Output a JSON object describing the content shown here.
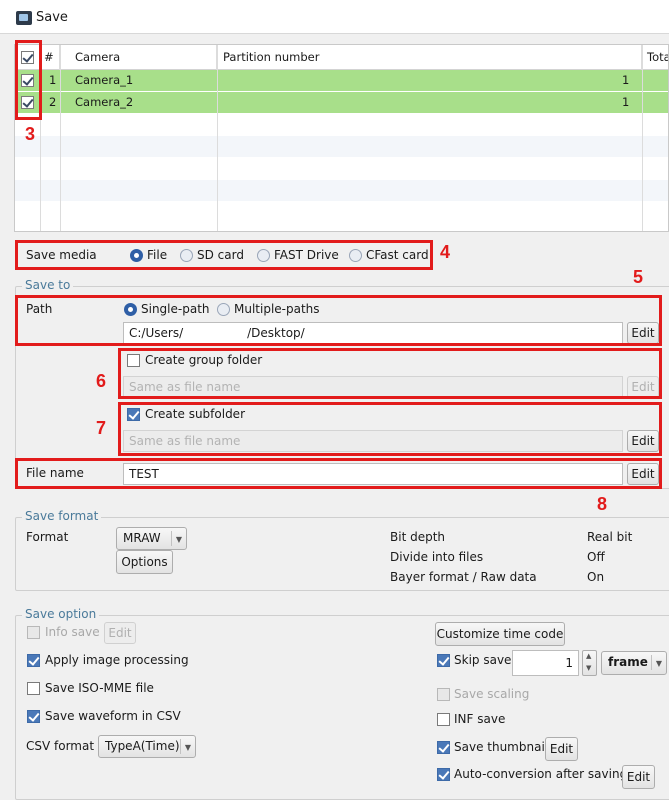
{
  "window": {
    "title": "Save"
  },
  "table": {
    "headers": {
      "index": "#",
      "camera": "Camera",
      "partition": "Partition number",
      "total": "Tota"
    },
    "rows": [
      {
        "index": "1",
        "camera": "Camera_1",
        "partition": "1",
        "checked": true
      },
      {
        "index": "2",
        "camera": "Camera_2",
        "partition": "1",
        "checked": true
      }
    ],
    "header_checked": true
  },
  "save_media": {
    "label": "Save media",
    "options": [
      "File",
      "SD card",
      "FAST Drive",
      "CFast card"
    ],
    "selected": "File"
  },
  "save_to": {
    "title": "Save to",
    "path_label": "Path",
    "path_modes": [
      "Single-path",
      "Multiple-paths"
    ],
    "path_mode_selected": "Single-path",
    "path_value_a": "C:/Users/",
    "path_value_b": "/Desktop/",
    "edit_label": "Edit",
    "group_folder_label": "Create group folder",
    "group_folder_checked": false,
    "group_folder_placeholder": "Same as file name",
    "subfolder_label": "Create subfolder",
    "subfolder_checked": true,
    "subfolder_placeholder": "Same as file name",
    "file_name_label": "File name",
    "file_name_value": "TEST"
  },
  "save_format": {
    "title": "Save format",
    "format_label": "Format",
    "format_value": "MRAW",
    "options_label": "Options",
    "bit_depth_label": "Bit depth",
    "bit_depth_value": "Real bit",
    "divide_label": "Divide into files",
    "divide_value": "Off",
    "bayer_label": "Bayer format / Raw data",
    "bayer_value": "On"
  },
  "save_option": {
    "title": "Save option",
    "info_save": "Info save",
    "info_edit": "Edit",
    "apply_image_processing": "Apply image processing",
    "save_iso_mme": "Save ISO-MME file",
    "save_waveform": "Save waveform in CSV",
    "csv_format_label": "CSV format",
    "csv_format_value": "TypeA(Time)",
    "customize_time_code": "Customize time code",
    "skip_save": "Skip save",
    "skip_value": "1",
    "skip_unit": "frame",
    "save_scaling": "Save scaling",
    "inf_save": "INF save",
    "save_thumbnail": "Save thumbnail",
    "thumbnail_edit": "Edit",
    "auto_conversion": "Auto-conversion after saving",
    "auto_edit": "Edit"
  },
  "callouts": {
    "c3": "3",
    "c4": "4",
    "c5": "5",
    "c6": "6",
    "c7": "7",
    "c8": "8"
  },
  "colors": {
    "selected_row": "#a8df8a",
    "callout_red": "#e21b1b",
    "accent_blue": "#2f5fa6",
    "group_title": "#4a7a9a"
  }
}
